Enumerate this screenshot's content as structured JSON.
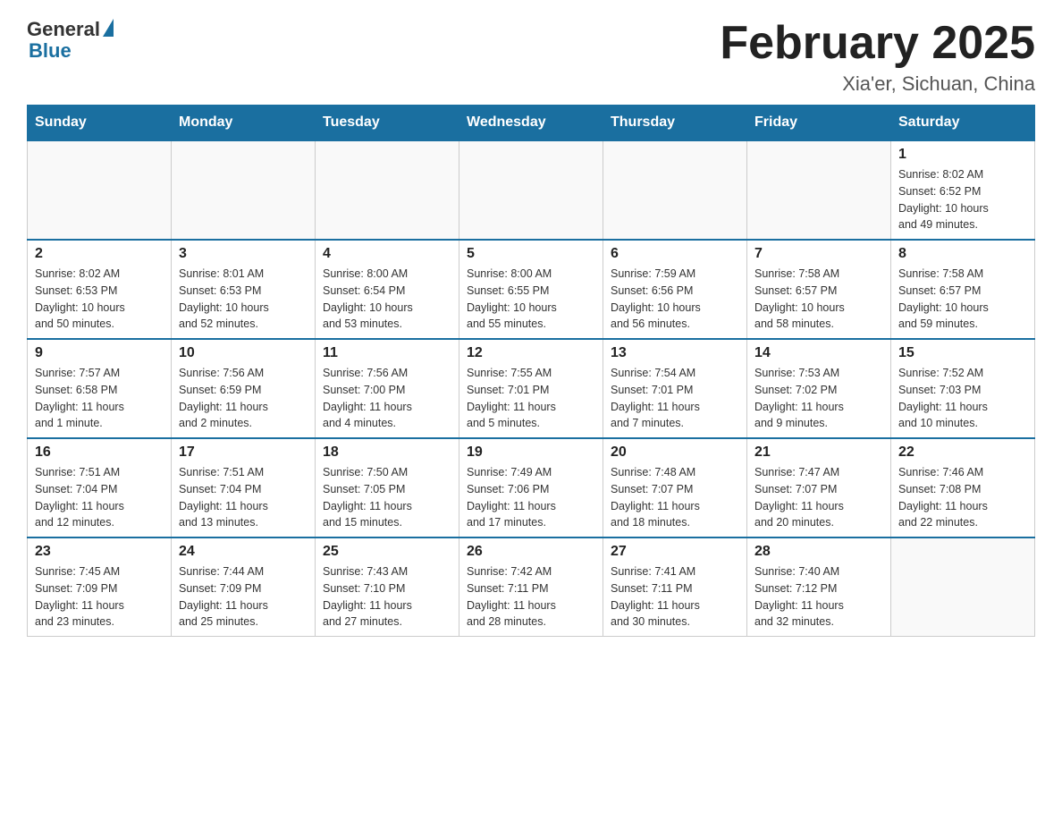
{
  "header": {
    "logo_general": "General",
    "logo_blue": "Blue",
    "title": "February 2025",
    "location": "Xia'er, Sichuan, China"
  },
  "weekdays": [
    "Sunday",
    "Monday",
    "Tuesday",
    "Wednesday",
    "Thursday",
    "Friday",
    "Saturday"
  ],
  "weeks": [
    [
      {
        "day": "",
        "info": ""
      },
      {
        "day": "",
        "info": ""
      },
      {
        "day": "",
        "info": ""
      },
      {
        "day": "",
        "info": ""
      },
      {
        "day": "",
        "info": ""
      },
      {
        "day": "",
        "info": ""
      },
      {
        "day": "1",
        "info": "Sunrise: 8:02 AM\nSunset: 6:52 PM\nDaylight: 10 hours\nand 49 minutes."
      }
    ],
    [
      {
        "day": "2",
        "info": "Sunrise: 8:02 AM\nSunset: 6:53 PM\nDaylight: 10 hours\nand 50 minutes."
      },
      {
        "day": "3",
        "info": "Sunrise: 8:01 AM\nSunset: 6:53 PM\nDaylight: 10 hours\nand 52 minutes."
      },
      {
        "day": "4",
        "info": "Sunrise: 8:00 AM\nSunset: 6:54 PM\nDaylight: 10 hours\nand 53 minutes."
      },
      {
        "day": "5",
        "info": "Sunrise: 8:00 AM\nSunset: 6:55 PM\nDaylight: 10 hours\nand 55 minutes."
      },
      {
        "day": "6",
        "info": "Sunrise: 7:59 AM\nSunset: 6:56 PM\nDaylight: 10 hours\nand 56 minutes."
      },
      {
        "day": "7",
        "info": "Sunrise: 7:58 AM\nSunset: 6:57 PM\nDaylight: 10 hours\nand 58 minutes."
      },
      {
        "day": "8",
        "info": "Sunrise: 7:58 AM\nSunset: 6:57 PM\nDaylight: 10 hours\nand 59 minutes."
      }
    ],
    [
      {
        "day": "9",
        "info": "Sunrise: 7:57 AM\nSunset: 6:58 PM\nDaylight: 11 hours\nand 1 minute."
      },
      {
        "day": "10",
        "info": "Sunrise: 7:56 AM\nSunset: 6:59 PM\nDaylight: 11 hours\nand 2 minutes."
      },
      {
        "day": "11",
        "info": "Sunrise: 7:56 AM\nSunset: 7:00 PM\nDaylight: 11 hours\nand 4 minutes."
      },
      {
        "day": "12",
        "info": "Sunrise: 7:55 AM\nSunset: 7:01 PM\nDaylight: 11 hours\nand 5 minutes."
      },
      {
        "day": "13",
        "info": "Sunrise: 7:54 AM\nSunset: 7:01 PM\nDaylight: 11 hours\nand 7 minutes."
      },
      {
        "day": "14",
        "info": "Sunrise: 7:53 AM\nSunset: 7:02 PM\nDaylight: 11 hours\nand 9 minutes."
      },
      {
        "day": "15",
        "info": "Sunrise: 7:52 AM\nSunset: 7:03 PM\nDaylight: 11 hours\nand 10 minutes."
      }
    ],
    [
      {
        "day": "16",
        "info": "Sunrise: 7:51 AM\nSunset: 7:04 PM\nDaylight: 11 hours\nand 12 minutes."
      },
      {
        "day": "17",
        "info": "Sunrise: 7:51 AM\nSunset: 7:04 PM\nDaylight: 11 hours\nand 13 minutes."
      },
      {
        "day": "18",
        "info": "Sunrise: 7:50 AM\nSunset: 7:05 PM\nDaylight: 11 hours\nand 15 minutes."
      },
      {
        "day": "19",
        "info": "Sunrise: 7:49 AM\nSunset: 7:06 PM\nDaylight: 11 hours\nand 17 minutes."
      },
      {
        "day": "20",
        "info": "Sunrise: 7:48 AM\nSunset: 7:07 PM\nDaylight: 11 hours\nand 18 minutes."
      },
      {
        "day": "21",
        "info": "Sunrise: 7:47 AM\nSunset: 7:07 PM\nDaylight: 11 hours\nand 20 minutes."
      },
      {
        "day": "22",
        "info": "Sunrise: 7:46 AM\nSunset: 7:08 PM\nDaylight: 11 hours\nand 22 minutes."
      }
    ],
    [
      {
        "day": "23",
        "info": "Sunrise: 7:45 AM\nSunset: 7:09 PM\nDaylight: 11 hours\nand 23 minutes."
      },
      {
        "day": "24",
        "info": "Sunrise: 7:44 AM\nSunset: 7:09 PM\nDaylight: 11 hours\nand 25 minutes."
      },
      {
        "day": "25",
        "info": "Sunrise: 7:43 AM\nSunset: 7:10 PM\nDaylight: 11 hours\nand 27 minutes."
      },
      {
        "day": "26",
        "info": "Sunrise: 7:42 AM\nSunset: 7:11 PM\nDaylight: 11 hours\nand 28 minutes."
      },
      {
        "day": "27",
        "info": "Sunrise: 7:41 AM\nSunset: 7:11 PM\nDaylight: 11 hours\nand 30 minutes."
      },
      {
        "day": "28",
        "info": "Sunrise: 7:40 AM\nSunset: 7:12 PM\nDaylight: 11 hours\nand 32 minutes."
      },
      {
        "day": "",
        "info": ""
      }
    ]
  ]
}
